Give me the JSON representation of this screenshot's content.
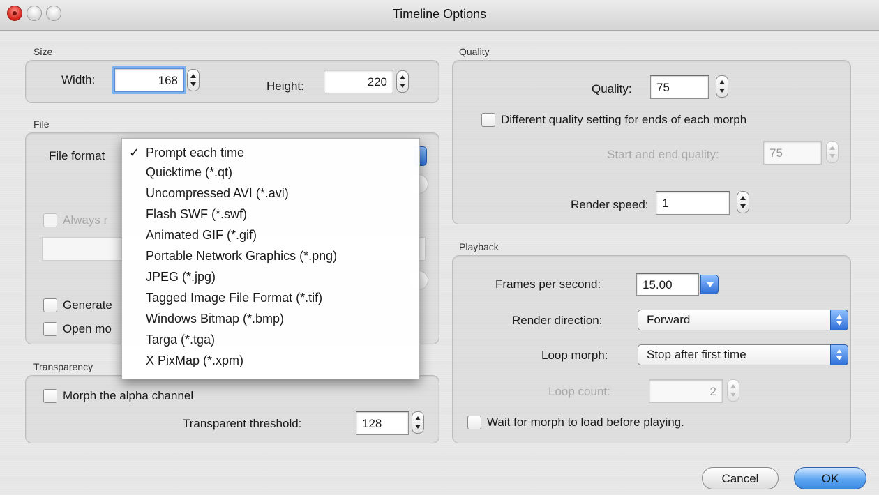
{
  "window": {
    "title": "Timeline Options"
  },
  "size": {
    "label": "Size",
    "width_label": "Width:",
    "width_value": "168",
    "height_label": "Height:",
    "height_value": "220"
  },
  "file": {
    "label": "File",
    "format_label": "File format",
    "always_label": "Always r",
    "generate_label": "Generate",
    "open_label": "Open mo",
    "format_menu": {
      "selected_index": 0,
      "check_glyph": "✓",
      "items": [
        "Prompt each time",
        "Quicktime (*.qt)",
        "Uncompressed AVI (*.avi)",
        "Flash SWF (*.swf)",
        "Animated GIF (*.gif)",
        "Portable Network Graphics (*.png)",
        "JPEG (*.jpg)",
        "Tagged Image File Format (*.tif)",
        "Windows Bitmap (*.bmp)",
        "Targa (*.tga)",
        "X PixMap (*.xpm)"
      ]
    }
  },
  "transparency": {
    "label": "Transparency",
    "morph_alpha_label": "Morph the alpha channel",
    "threshold_label": "Transparent threshold:",
    "threshold_value": "128"
  },
  "quality": {
    "label": "Quality",
    "quality_label": "Quality:",
    "quality_value": "75",
    "different_label": "Different quality setting for ends of each morph",
    "start_end_label": "Start and end quality:",
    "start_end_value": "75",
    "render_speed_label": "Render speed:",
    "render_speed_value": "1"
  },
  "playback": {
    "label": "Playback",
    "fps_label": "Frames per second:",
    "fps_value": "15.00",
    "direction_label": "Render direction:",
    "direction_value": "Forward",
    "loop_label": "Loop morph:",
    "loop_value": "Stop after first time",
    "loop_count_label": "Loop count:",
    "loop_count_value": "2",
    "wait_label": "Wait for morph to load before playing."
  },
  "buttons": {
    "cancel": "Cancel",
    "ok": "OK"
  },
  "colors": {
    "accent": "#3d8ae2",
    "close_red": "#d3241a"
  }
}
